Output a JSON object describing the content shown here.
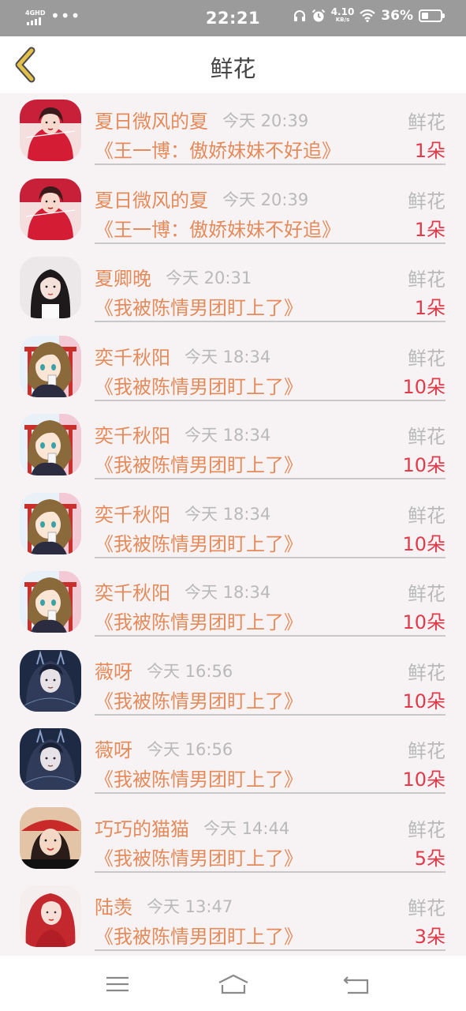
{
  "status_bar": {
    "network": "4GHD",
    "time": "22:21",
    "speed_value": "4.10",
    "speed_unit": "KB/s",
    "battery": "36%",
    "battery_level": 0.36,
    "icons": [
      "signal-icon",
      "headphones-icon",
      "alarm-icon",
      "wifi-icon",
      "battery-icon"
    ]
  },
  "header": {
    "title": "鲜花",
    "back_icon": "chevron-left-icon"
  },
  "items": [
    {
      "name": "夏日微风的夏",
      "time": "今天 20:39",
      "type": "鲜花",
      "book": "《王一博：傲娇妹妹不好追》",
      "count": "1朵",
      "avatar": "red-dress-girl"
    },
    {
      "name": "夏日微风的夏",
      "time": "今天 20:39",
      "type": "鲜花",
      "book": "《王一博：傲娇妹妹不好追》",
      "count": "1朵",
      "avatar": "red-dress-girl"
    },
    {
      "name": "夏卿晚",
      "time": "今天 20:31",
      "type": "鲜花",
      "book": "《我被陈情男团盯上了》",
      "count": "1朵",
      "avatar": "dark-hair-girl"
    },
    {
      "name": "奕千秋阳",
      "time": "今天 18:34",
      "type": "鲜花",
      "book": "《我被陈情男团盯上了》",
      "count": "10朵",
      "avatar": "anime-girl"
    },
    {
      "name": "奕千秋阳",
      "time": "今天 18:34",
      "type": "鲜花",
      "book": "《我被陈情男团盯上了》",
      "count": "10朵",
      "avatar": "anime-girl"
    },
    {
      "name": "奕千秋阳",
      "time": "今天 18:34",
      "type": "鲜花",
      "book": "《我被陈情男团盯上了》",
      "count": "10朵",
      "avatar": "anime-girl"
    },
    {
      "name": "奕千秋阳",
      "time": "今天 18:34",
      "type": "鲜花",
      "book": "《我被陈情男团盯上了》",
      "count": "10朵",
      "avatar": "anime-girl"
    },
    {
      "name": "薇呀",
      "time": "今天 16:56",
      "type": "鲜花",
      "book": "《我被陈情男团盯上了》",
      "count": "10朵",
      "avatar": "dark-fantasy-girl"
    },
    {
      "name": "薇呀",
      "time": "今天 16:56",
      "type": "鲜花",
      "book": "《我被陈情男团盯上了》",
      "count": "10朵",
      "avatar": "dark-fantasy-girl"
    },
    {
      "name": "巧巧的猫猫",
      "time": "今天 14:44",
      "type": "鲜花",
      "book": "《我被陈情男团盯上了》",
      "count": "5朵",
      "avatar": "hat-girl"
    },
    {
      "name": "陆羡",
      "time": "今天 13:47",
      "type": "鲜花",
      "book": "《我被陈情男团盯上了》",
      "count": "3朵",
      "avatar": "red-hair-girl"
    }
  ],
  "nav": {
    "icons": [
      "menu-icon",
      "home-icon",
      "back-icon"
    ]
  },
  "colors": {
    "accent_orange": "#e58a5a",
    "count_red": "#e03b4a",
    "muted_gray": "#b9b9b9",
    "back_arrow": "#d9b43a"
  }
}
